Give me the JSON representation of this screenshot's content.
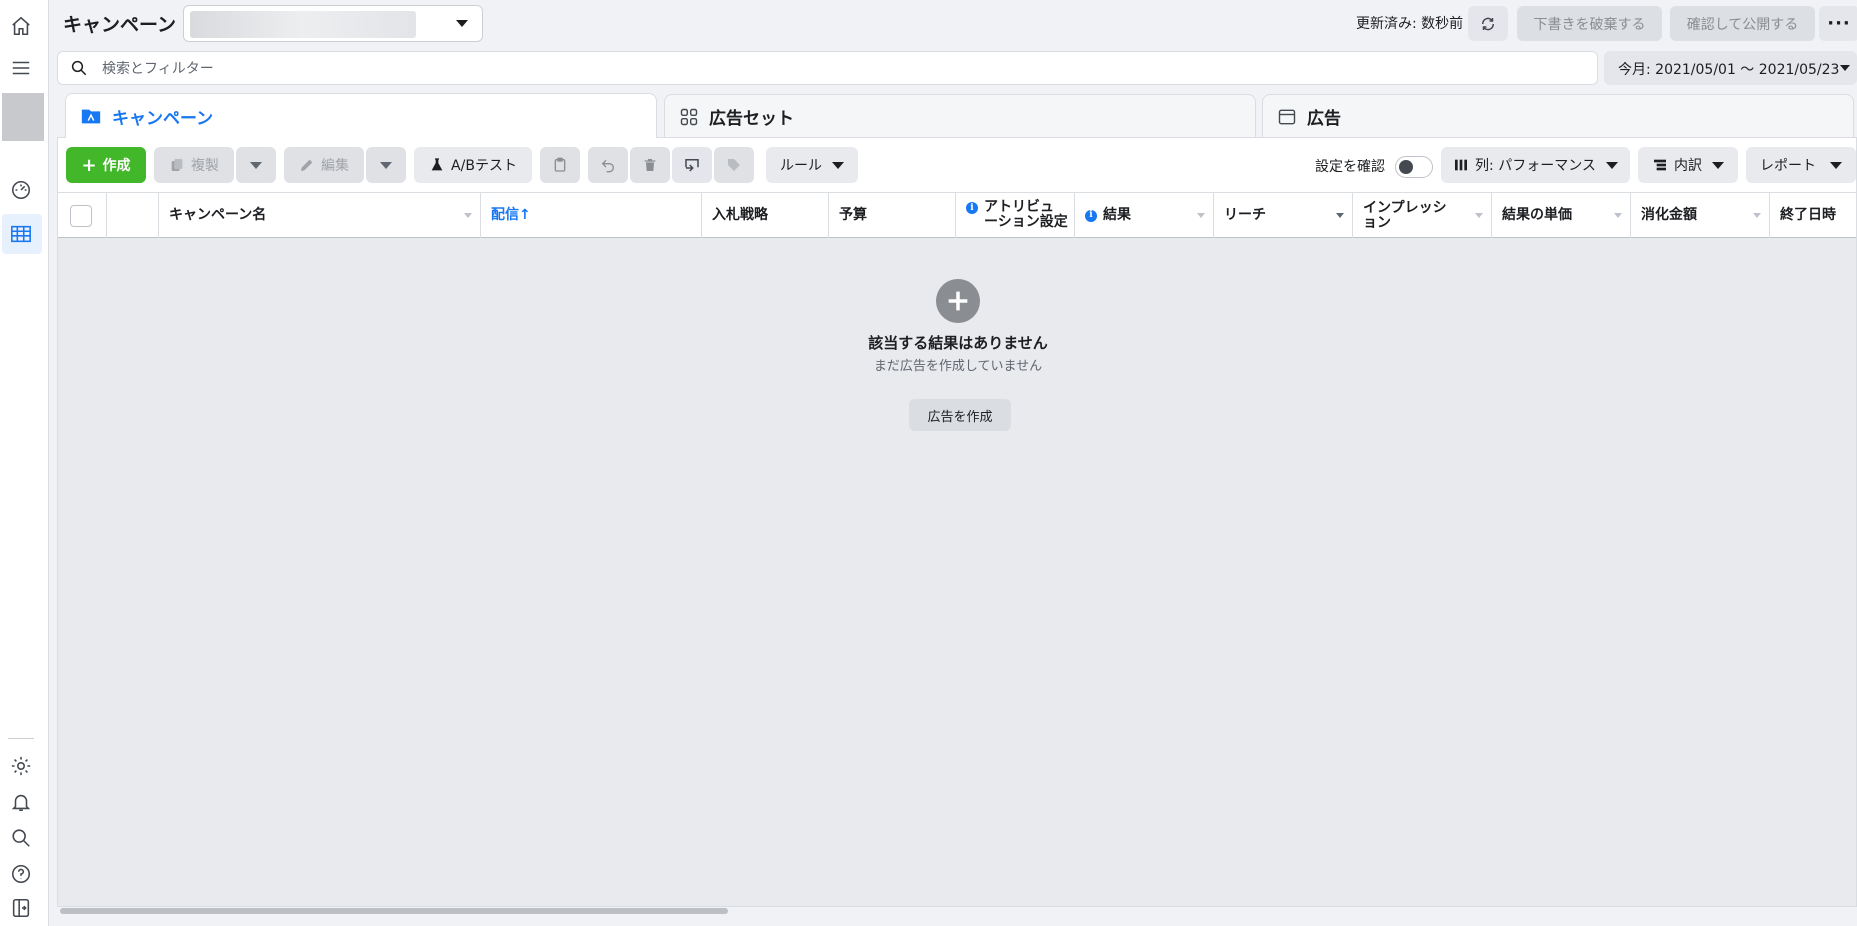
{
  "header": {
    "title": "キャンペーン",
    "updated_text": "更新済み: 数秒前",
    "discard_label": "下書きを破棄する",
    "publish_label": "確認して公開する",
    "more_label": "···"
  },
  "search": {
    "placeholder": "検索とフィルター"
  },
  "date_range": {
    "label": "今月: 2021/05/01 ～ 2021/05/23"
  },
  "tabs": [
    {
      "label": "キャンペーン",
      "active": true
    },
    {
      "label": "広告セット",
      "active": false
    },
    {
      "label": "広告",
      "active": false
    }
  ],
  "toolbar": {
    "create_label": "作成",
    "duplicate_label": "複製",
    "edit_label": "編集",
    "ab_test_label": "A/Bテスト",
    "rules_label": "ルール",
    "review_settings_label": "設定を確認",
    "columns_label": "列: パフォーマンス",
    "breakdown_label": "内訳",
    "report_label": "レポート"
  },
  "table": {
    "columns": [
      "キャンペーン名",
      "配信↑",
      "入札戦略",
      "予算",
      "アトリビュ\nーション設定",
      "結果",
      "リーチ",
      "インプレッシ\nョン",
      "結果の単価",
      "消化金額",
      "終了日時"
    ]
  },
  "empty_state": {
    "title": "該当する結果はありません",
    "subtitle": "まだ広告を作成していません",
    "button_label": "広告を作成"
  },
  "colors": {
    "accent": "#1877f2",
    "create_green": "#42b72a"
  }
}
